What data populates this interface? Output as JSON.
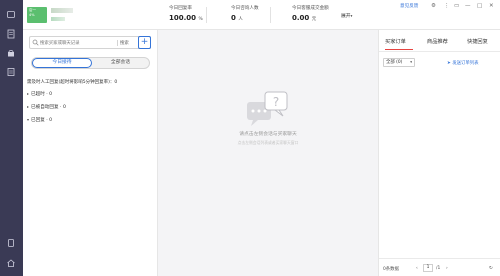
{
  "profile": {
    "avatar_text": "店一\n4%"
  },
  "stats": [
    {
      "label": "今日回复率",
      "value": "100.00",
      "unit": "%"
    },
    {
      "label": "今日咨询人数",
      "value": "0",
      "unit": "人"
    },
    {
      "label": "今日客服成交金额",
      "value": "0.00",
      "unit": "元"
    }
  ],
  "topbar": {
    "expand_label": "展开",
    "feedback_label": "意见反馈"
  },
  "left": {
    "search_placeholder": "搜索买家或聊天记录",
    "search_button": "搜索",
    "add_symbol": "+",
    "tabs": {
      "active": "今日接待",
      "inactive": "全部会话"
    },
    "group_title": "需及时人工回复(超时将影响5分钟回复率)：0",
    "groups": [
      {
        "label": "已超时 · 0"
      },
      {
        "label": "已被自动回复 · 0"
      },
      {
        "label": "已回复 · 0"
      }
    ]
  },
  "middle": {
    "empty_title": "请点击左侧会话与买家聊天",
    "empty_sub": "点击左侧会话列表或者买家聊天窗口"
  },
  "right": {
    "tabs": [
      "买家订单",
      "商品推荐",
      "快捷回复"
    ],
    "filter": "全部 (0)",
    "send_link": "发送订单列表",
    "page_count": "0条数据",
    "page_current": "1",
    "page_total": "/1"
  },
  "colors": {
    "accent": "#3574d8",
    "sidebar": "#3a3a55",
    "active_tab": "#e64340"
  }
}
